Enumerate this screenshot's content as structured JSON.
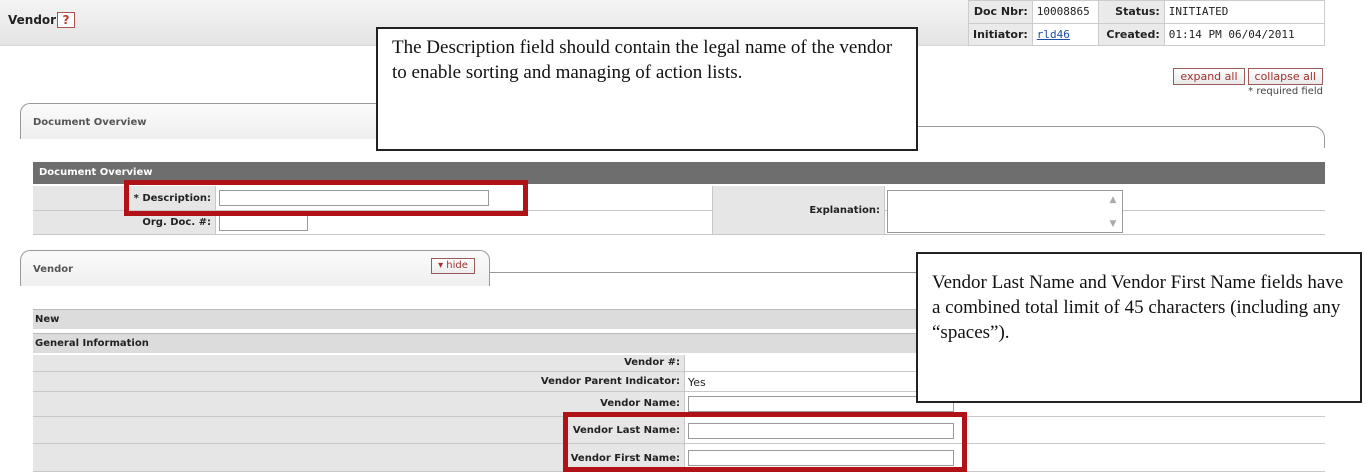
{
  "header": {
    "title": "Vendor",
    "help_icon": "?",
    "doc_nbr_label": "Doc Nbr:",
    "doc_nbr": "10008865",
    "status_label": "Status:",
    "status": "INITIATED",
    "initiator_label": "Initiator:",
    "initiator": "rld46",
    "created_label": "Created:",
    "created": "01:14 PM 06/04/2011"
  },
  "actions": {
    "expand_all": "expand all",
    "collapse_all": "collapse all",
    "required_note": "* required field"
  },
  "document_overview": {
    "tab_label": "Document Overview",
    "section_title": "Document Overview",
    "description_label": "* Description:",
    "description_value": "",
    "org_doc_label": "Org. Doc. #:",
    "org_doc_value": "",
    "explanation_label": "Explanation:",
    "explanation_value": ""
  },
  "vendor": {
    "tab_label": "Vendor",
    "hide_label": "▾ hide",
    "new_label": "New",
    "general_info_label": "General Information",
    "fields": [
      {
        "label": "Vendor #:",
        "value": ""
      },
      {
        "label": "Vendor Parent Indicator:",
        "value": "Yes"
      },
      {
        "label": "Vendor Name:",
        "value": ""
      },
      {
        "label": "Vendor Last Name:",
        "value": ""
      },
      {
        "label": "Vendor First Name:",
        "value": ""
      }
    ]
  },
  "callouts": {
    "description_note": "The Description field should contain the legal name of the vendor to enable sorting and managing of action lists.",
    "name_limit_note": "Vendor Last Name and Vendor First Name fields have a combined total limit of 45 characters (including any “spaces”)."
  },
  "colors": {
    "highlight": "#b01217",
    "section_bar": "#6e6e6e",
    "link": "#1d4ea0"
  }
}
